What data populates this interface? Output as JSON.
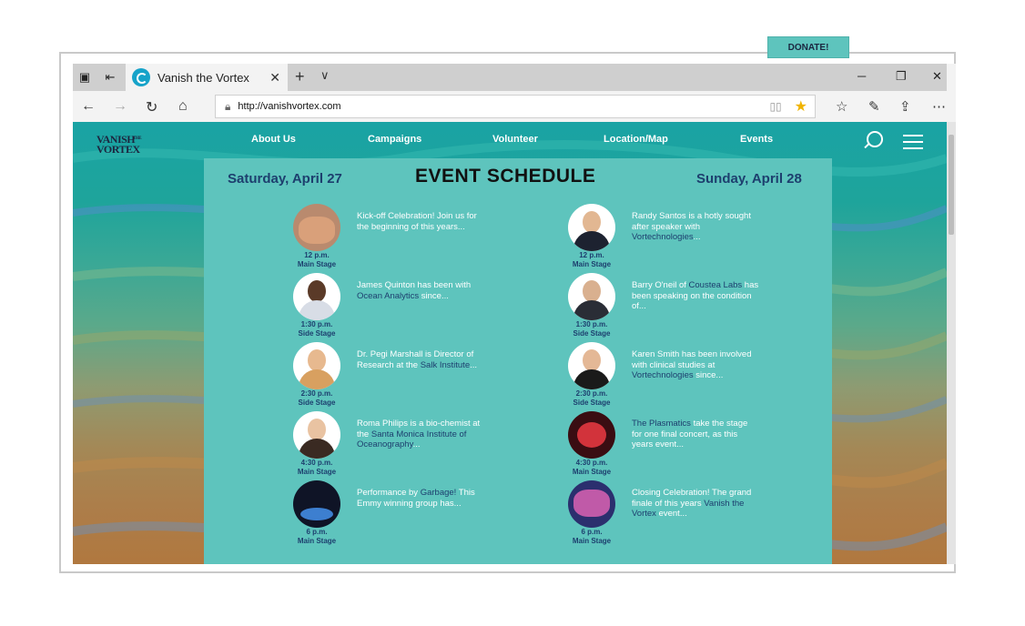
{
  "browser": {
    "tab_title": "Vanish the Vortex",
    "tab_close": "✕",
    "new_tab": "+",
    "tab_menu": "∨",
    "url": "http://vanishvortex.com",
    "win_min": "─",
    "win_max": "❐",
    "win_close": "✕"
  },
  "site": {
    "logo_line1": "VANISH",
    "logo_line2": "VORTEX",
    "logo_small": "THE",
    "nav": [
      "About Us",
      "Campaigns",
      "Volunteer",
      "Location/Map",
      "Events"
    ],
    "donate_label": "DONATE!"
  },
  "schedule": {
    "title": "EVENT SCHEDULE",
    "day_left": "Saturday, April 27",
    "day_right": "Sunday, April 28",
    "left": [
      {
        "time": "12 p.m.",
        "stage": "Main Stage",
        "pre": "Kick-off Celebration! Join us for the beginning of this years...",
        "hl": "",
        "post": ""
      },
      {
        "time": "1:30 p.m.",
        "stage": "Side Stage",
        "pre": "James Quinton has been with ",
        "hl": "Ocean Analytics",
        "post": " since..."
      },
      {
        "time": "2:30 p.m.",
        "stage": "Side Stage",
        "pre": "Dr. Pegi Marshall is Director of Research at the ",
        "hl": "Salk Institute",
        "post": "..."
      },
      {
        "time": "4:30 p.m.",
        "stage": "Main Stage",
        "pre": "Roma Philips is a bio-chemist at the ",
        "hl": "Santa Monica Institute of Oceanography",
        "post": "..."
      },
      {
        "time": "6 p.m.",
        "stage": "Main Stage",
        "pre": "Performance by ",
        "hl": "Garbage!",
        "post": " This Emmy winning group has..."
      }
    ],
    "right": [
      {
        "time": "12 p.m.",
        "stage": "Main Stage",
        "pre": "Randy Santos is a hotly sought after speaker with ",
        "hl": "Vortechnologies",
        "post": "..."
      },
      {
        "time": "1:30 p.m.",
        "stage": "Side Stage",
        "pre": "Barry O'neil of ",
        "hl": "Coustea Labs",
        "post": " has been speaking on the condition of..."
      },
      {
        "time": "2:30 p.m.",
        "stage": "Side Stage",
        "pre": "Karen Smith has been involved with clinical studies at ",
        "hl": "Vortechnologies",
        "post": " since..."
      },
      {
        "time": "4:30 p.m.",
        "stage": "Main Stage",
        "pre": "",
        "hl": "The Plasmatics",
        "post": " take the stage for one final concert, as this years event..."
      },
      {
        "time": "6 p.m.",
        "stage": "Main Stage",
        "pre": "Closing Celebration! The grand finale of this years ",
        "hl": "Vanish the Vortex",
        "post": " event..."
      }
    ]
  },
  "colors": {
    "teal_panel": "#5ec4bd",
    "navy_text": "#1d3f6e",
    "accent_star": "#f0b400"
  }
}
